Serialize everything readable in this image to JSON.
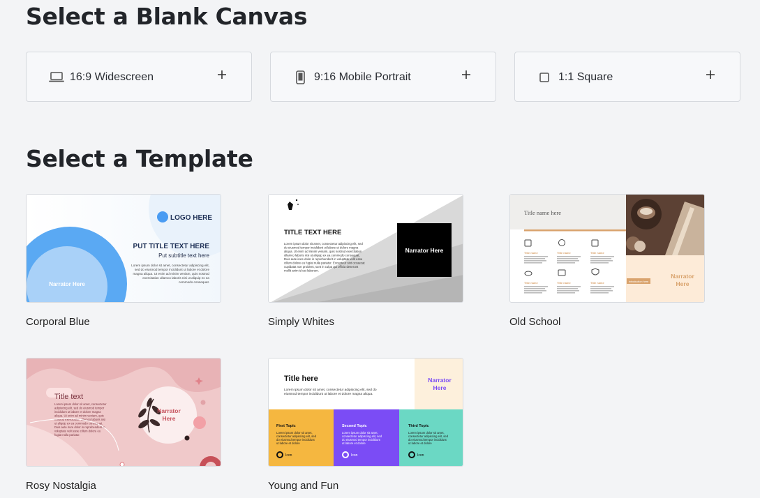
{
  "blank_canvas": {
    "heading": "Select a Blank Canvas",
    "options": [
      {
        "label": "16:9 Widescreen",
        "icon": "laptop-icon"
      },
      {
        "label": "9:16 Mobile Portrait",
        "icon": "mobile-icon"
      },
      {
        "label": "1:1 Square",
        "icon": "square-icon"
      }
    ]
  },
  "templates": {
    "heading": "Select a Template",
    "items": [
      {
        "name": "Corporal Blue",
        "preview": {
          "logo": "LOGO HERE",
          "title": "PUT TITLE TEXT HERE",
          "subtitle": "Put subtitle text here",
          "narrator": "Narrator Here",
          "body": [
            "Lorem ipsum dolor sit amet, consectetur adipiscing elit,",
            "sed do eiusmod tempor incididunt ut labore et dolore",
            "magna aliqua. Ut enim ad minim veniam, quis nostrud",
            "exercitation ullamco laboris nisi ut aliquip ex ea",
            "commodo consequat."
          ]
        }
      },
      {
        "name": "Simply Whites",
        "preview": {
          "title": "TITLE TEXT HERE",
          "narrator": "Narrator Here",
          "body": [
            "Lorem ipsum dolor sit amet, consectetur adipiscing elit, sed",
            "do eiusmod tempor incididunt ut labore et dolore magna",
            "aliqua. Ut enim ad minim veniam, quis nostrud exercitation",
            "ullamco laboris nisi ut aliquip ex ea commodo consequat.",
            "Duis aute irure dolor in reprehenderit in voluptate velit esse",
            "cillum dolore eu fugiat nulla pariatur. Excepteur sint occaecat",
            "cupidatat non proident, sunt in culpa qui officia deserunt",
            "mollit anim id est laborum."
          ]
        }
      },
      {
        "name": "Old School",
        "preview": {
          "title": "Title name here",
          "narrator": [
            "Narrator",
            "Here"
          ],
          "topic_label": "Title name",
          "button": "introduction here"
        }
      },
      {
        "name": "Rosy Nostalgia",
        "preview": {
          "title": "Title text",
          "narrator": [
            "Narrator",
            "Here"
          ],
          "body": [
            "Lorem ipsum dolor sit amet, consectetur",
            "adipiscing elit, sed do eiusmod tempor",
            "incididunt ut labore et dolore magna",
            "aliqua. Ut enim ad minim veniam, quis",
            "nostrud exercitation ullamco laboris nisi",
            "ut aliquip ex ea commodo consequat.",
            "Duis aute irure dolor in reprehenderit in",
            "voluptate velit esse cillum dolore eu",
            "fugiat nulla pariatur."
          ]
        }
      },
      {
        "name": "Young and Fun",
        "preview": {
          "title": "Title here",
          "narrator": [
            "Narrator",
            "Here"
          ],
          "body": [
            "Lorem ipsum dolor sit amet, consectetur adipiscing elit, sed do",
            "eiusmod tempor incididunt ut labore et dolore magna aliqua."
          ],
          "topics": [
            {
              "title": "First Topic",
              "body": [
                "Lorem ipsum dolor sit amet,",
                "consectetur adipiscing elit, sed",
                "do eiusmod tempor incididunt",
                "ut labore et dolore"
              ],
              "icon_label": "Icon",
              "color": "#f5b740"
            },
            {
              "title": "Second Topic",
              "body": [
                "Lorem ipsum dolor sit amet,",
                "consectetur adipiscing elit, sed",
                "do eiusmod tempor incididunt",
                "ut labore et dolore"
              ],
              "icon_label": "Icon",
              "color": "#7b4cf5"
            },
            {
              "title": "Third Topic",
              "body": [
                "Lorem ipsum dolor sit amet,",
                "consectetur adipiscing elit, sed",
                "do eiusmod tempor incididunt",
                "ut labore et dolore"
              ],
              "icon_label": "Icon",
              "color": "#6bd8c4"
            }
          ]
        }
      }
    ]
  }
}
